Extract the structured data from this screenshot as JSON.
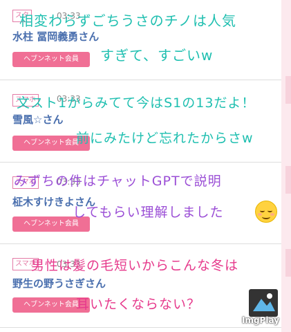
{
  "feed": [
    {
      "badge": "スタ",
      "time": "03:33",
      "username": "水柱 冨岡義勇さん",
      "member_label": "ヘブンネット会員"
    },
    {
      "badge": "スマホ",
      "time": "03:33",
      "username": "雪風☆さん",
      "member_label": "ヘブンネット会員"
    },
    {
      "badge": "スマホ",
      "time": "03:33",
      "username": "柾木すけきよさん",
      "member_label": "ヘブンネット会員"
    },
    {
      "badge": "スマホ",
      "time": "03:33",
      "username": "野生の野うさぎさん",
      "member_label": "ヘブンネット会員"
    }
  ],
  "overlay_comments": [
    {
      "line1": "相変わらずごちうさのチノは人気",
      "line2": "すぎて、すごいw",
      "color": "#1fbfb0"
    },
    {
      "line1": "文スト1からみてて今はS1の13だよ！",
      "line2": "前にみたけど忘れたからさw",
      "color": "#1fbfb0"
    },
    {
      "line1": "みずちの件はチャットGPTで説明",
      "line2": "してもらい理解しました",
      "color": "#9b4fd6"
    },
    {
      "line1": "男性は髪の毛短いからこんな冬は",
      "line2": "耳いたくならない？",
      "color": "#e63a8c"
    }
  ],
  "watermark": {
    "text": "ImgPlay",
    "icon": "imgplay-logo-icon"
  },
  "emoji": {
    "icon": "smiling-face-icon"
  }
}
